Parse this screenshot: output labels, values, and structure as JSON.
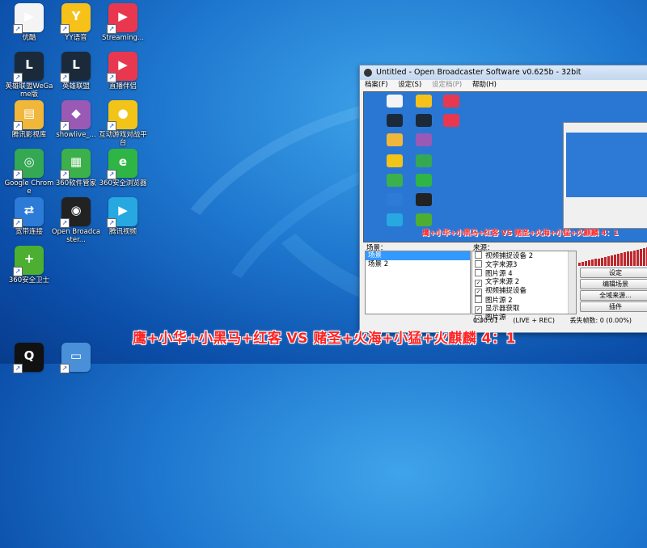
{
  "desktop": {
    "icons": [
      {
        "label": "优酷",
        "icon": "youku-icon",
        "color": "#f4f4f4",
        "glyph": "▶"
      },
      {
        "label": "YY语音",
        "icon": "yy-voice-icon",
        "color": "#f6c21a",
        "glyph": "Y"
      },
      {
        "label": "Streaming...",
        "icon": "streaming-icon",
        "color": "#e8384f",
        "glyph": "▶"
      },
      {
        "label": "英雄联盟WeGame版",
        "icon": "lol-wegame-icon",
        "color": "#1b2a3a",
        "glyph": "L"
      },
      {
        "label": "英雄联盟",
        "icon": "lol-icon",
        "color": "#1b2a3a",
        "glyph": "L"
      },
      {
        "label": "直播伴侣",
        "icon": "live-companion-icon",
        "color": "#e8384f",
        "glyph": "▶"
      },
      {
        "label": "腾讯影视库",
        "icon": "tencent-video-library-icon",
        "color": "#f0b73b",
        "glyph": "▤"
      },
      {
        "label": "showlive_...",
        "icon": "showlive-icon",
        "color": "#9b59b6",
        "glyph": "◆"
      },
      {
        "label": "互动游戏对战平台",
        "icon": "game-platform-icon",
        "color": "#f2c418",
        "glyph": "●"
      },
      {
        "label": "Google Chrome",
        "icon": "chrome-icon",
        "color": "#34a853",
        "glyph": "◎"
      },
      {
        "label": "360软件管家",
        "icon": "360-software-icon",
        "color": "#3cb04a",
        "glyph": "▦"
      },
      {
        "label": "360安全浏览器",
        "icon": "360-browser-icon",
        "color": "#2fb446",
        "glyph": "e"
      },
      {
        "label": "宽带连接",
        "icon": "broadband-icon",
        "color": "#2c7bd6",
        "glyph": "⇄"
      },
      {
        "label": "Open Broadcaster...",
        "icon": "obs-icon",
        "color": "#222222",
        "glyph": "◉"
      },
      {
        "label": "腾讯视频",
        "icon": "tencent-video-icon",
        "color": "#28a8e0",
        "glyph": "▶"
      },
      {
        "label": "360安全卫士",
        "icon": "360-safe-icon",
        "color": "#4caf32",
        "glyph": "+"
      },
      {
        "label": "",
        "icon": "qq-icon",
        "color": "#111111",
        "glyph": "Q"
      },
      {
        "label": "",
        "icon": "computer-icon",
        "color": "#4a90d9",
        "glyph": "▭"
      }
    ]
  },
  "obs": {
    "title": "Untitled - Open Broadcaster Software v0.625b - 32bit",
    "menu": [
      "档案(F)",
      "设定(S)",
      "设定档(P)",
      "帮助(H)"
    ],
    "preview_overlay": "鹰+小华+小黑马+红客 VS 赌圣+火海+小猛+火麒麟 4：1",
    "scenes_label": "场景：",
    "scenes": [
      "场景",
      "场景 2"
    ],
    "sources_label": "来源：",
    "sources": [
      {
        "label": "视频捕捉设备 2",
        "checked": false
      },
      {
        "label": "文字来源3",
        "checked": false
      },
      {
        "label": "图片源 4",
        "checked": false
      },
      {
        "label": "文字来源 2",
        "checked": true
      },
      {
        "label": "视频捕捉设备",
        "checked": true
      },
      {
        "label": "图片源 2",
        "checked": false
      },
      {
        "label": "显示器获取",
        "checked": true
      },
      {
        "label": "图片源",
        "checked": true
      }
    ],
    "buttons": [
      "设定",
      "编辑场景",
      "全域来源...",
      "插件"
    ],
    "status": {
      "time": "0:00:01",
      "mode": "(LIVE + REC)",
      "dropped": "丢失帧数: 0 (0.00%)"
    }
  },
  "overlay_text": "鹰+小华+小黑马+红客 VS 赌圣+火海+小猛+火麒麟 4：1"
}
